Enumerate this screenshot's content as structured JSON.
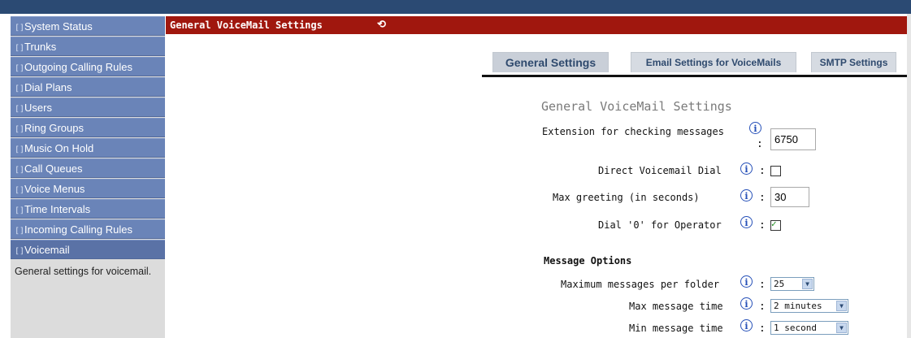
{
  "sidebar": {
    "items": [
      {
        "label": "System Status"
      },
      {
        "label": "Trunks"
      },
      {
        "label": "Outgoing Calling Rules"
      },
      {
        "label": "Dial Plans"
      },
      {
        "label": "Users"
      },
      {
        "label": "Ring Groups"
      },
      {
        "label": "Music On Hold"
      },
      {
        "label": "Call Queues"
      },
      {
        "label": "Voice Menus"
      },
      {
        "label": "Time Intervals"
      },
      {
        "label": "Incoming Calling Rules"
      },
      {
        "label": "Voicemail"
      }
    ],
    "help_text": "General settings for voicemail."
  },
  "header": {
    "title": "General VoiceMail Settings"
  },
  "tabs": {
    "general": "General Settings",
    "email": "Email Settings for VoiceMails",
    "smtp": "SMTP Settings"
  },
  "form": {
    "section_title": "General VoiceMail Settings",
    "extension_label": "Extension for checking messages",
    "extension_value": "6750",
    "direct_label": "Direct Voicemail Dial",
    "direct_checked": false,
    "max_greeting_label": "Max greeting (in seconds)",
    "max_greeting_value": "30",
    "dial0_label": "Dial '0' for Operator",
    "dial0_checked": true,
    "message_options_title": "Message Options",
    "max_messages_label": "Maximum messages per folder",
    "max_messages_value": "25",
    "max_time_label": "Max message time",
    "max_time_value": "2 minutes",
    "min_time_label": "Min message time",
    "min_time_value": "1 second",
    "colon": ":"
  },
  "glyphs": {
    "bracket": "[]",
    "info": "i",
    "refresh": "⟲",
    "check": "✓",
    "dropdown": "▼"
  },
  "colors": {
    "header_bg": "#a0170e",
    "nav_bg": "#6a84b8",
    "topbar": "#2b4a73"
  }
}
